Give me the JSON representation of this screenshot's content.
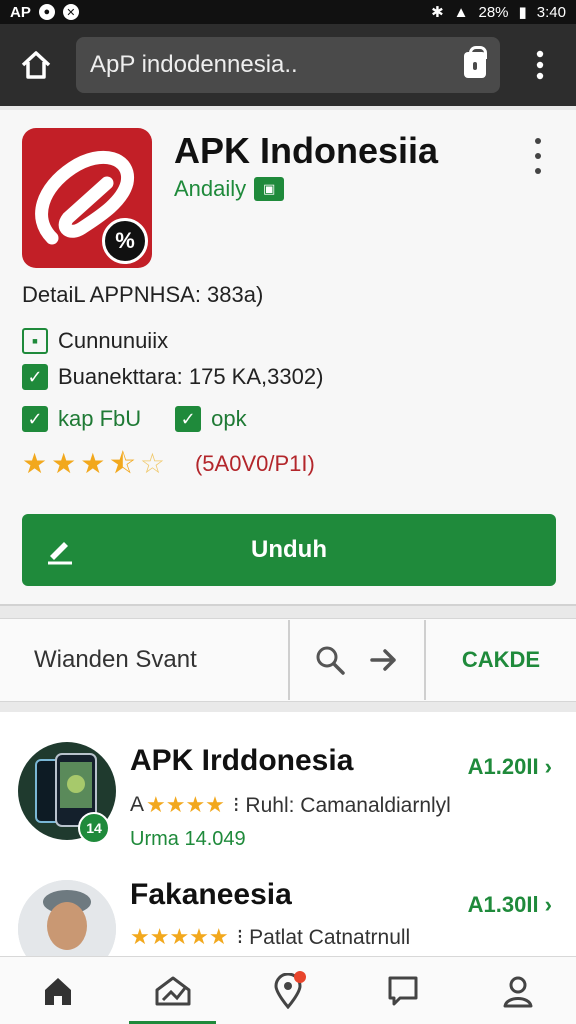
{
  "status_bar": {
    "left_label": "AP",
    "time": "3:40",
    "battery": "28%"
  },
  "browser": {
    "url": "ApP indodennesia.."
  },
  "app": {
    "title": "APK Indonesiia",
    "developer": "Andaily",
    "detail": "DetaiL APPNHSA: 383a)",
    "features": [
      {
        "label": "Cunnunuiix"
      },
      {
        "label": "Buanekttara: 175 KA,3302)"
      }
    ],
    "tags": [
      {
        "label": "kap FbU"
      },
      {
        "label": "opk"
      }
    ],
    "rating_stars": 3.5,
    "rating_code": "(5A0V0/P1I)",
    "download_label": "Unduh"
  },
  "search": {
    "label": "Wianden Svant",
    "cancel_label": "CAKDE"
  },
  "results": [
    {
      "name": "APK Irddonesia",
      "price": "A1.20II ›",
      "meta_prefix": "A",
      "meta_text": "⁝ Ruhl: Camanaldiarnlyl",
      "sub": "Urma 14.049",
      "badge": "14",
      "stars": 4
    },
    {
      "name": "Fakaneesia",
      "price": "A1.30Il ›",
      "meta_text": "⁝ Patlat Catnatrnull",
      "stars": 5
    }
  ],
  "colors": {
    "accent": "#1f8a3b",
    "brand_red": "#c21f27",
    "browser_bar": "#2d2d2d"
  }
}
